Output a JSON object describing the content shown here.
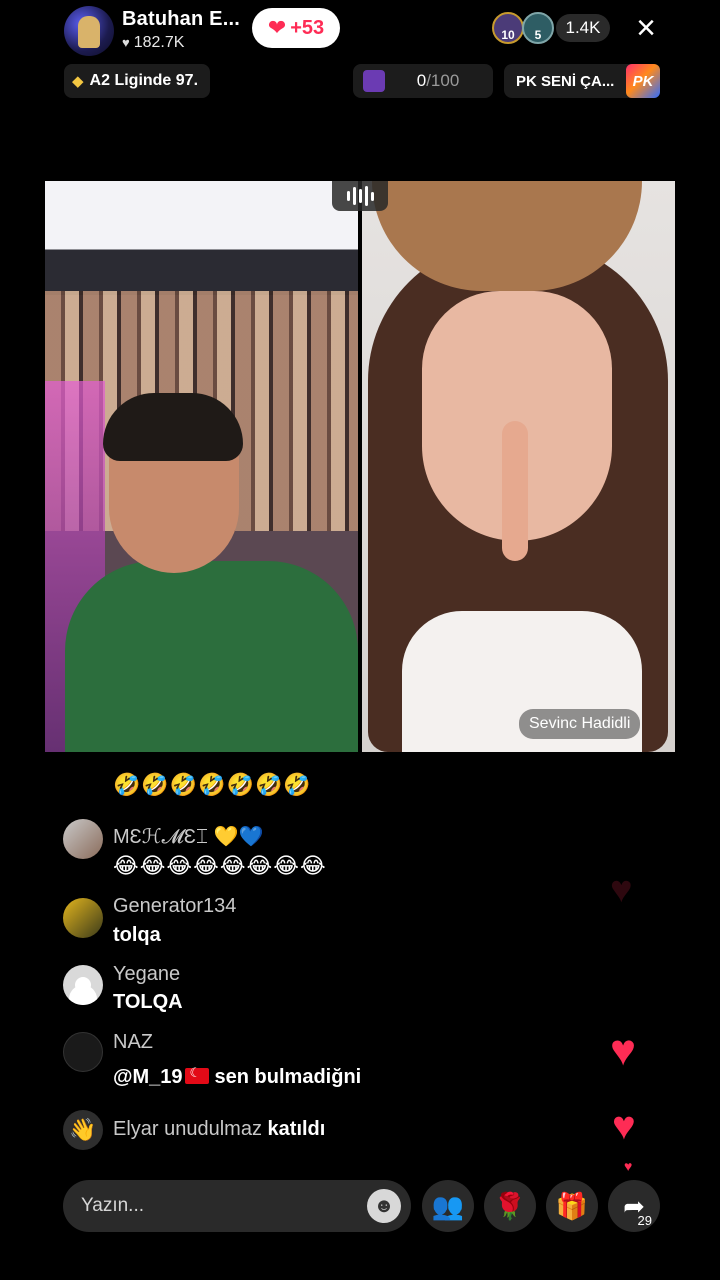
{
  "header": {
    "host_name": "Batuhan E...",
    "host_likes": "182.7K",
    "follow_count": "+53",
    "viewers": [
      {
        "rank": "10"
      },
      {
        "rank": "5"
      }
    ],
    "viewer_count": "1.4K",
    "close_icon": "×"
  },
  "info_row": {
    "league_text": "A2 Liginde 97.",
    "goal_value": "0",
    "goal_total": "/100",
    "pk_text": "PK SENİ ÇA...",
    "pk_badge": "PK"
  },
  "video": {
    "guest_name": "Sevinc Hadidli"
  },
  "chat": {
    "partial_emojis": "🤣🤣🤣🤣🤣🤣🤣",
    "messages": [
      {
        "name": "MƐℋ𝓜Ɛ⌶ 💛💙",
        "text": "😂😂😂😂😂😂😂😂"
      },
      {
        "name": "Generator134",
        "text": "tolqa"
      },
      {
        "name": "Yegane",
        "text": "TOLQA"
      },
      {
        "name": "NAZ",
        "mention": "@M_19",
        "text": "sen bulmadiğni"
      }
    ],
    "join": {
      "user": "Elyar unudulmaz",
      "action": "katıldı"
    }
  },
  "bottom_bar": {
    "input_placeholder": "Yazın...",
    "share_count": "29",
    "icons": [
      "emoji-icon",
      "co-host-icon",
      "rose-gift-icon",
      "gift-box-icon",
      "share-icon"
    ]
  },
  "colors": {
    "accent": "#fe2c55",
    "pill": "#2a2a2a",
    "gold": "#f3c742"
  }
}
